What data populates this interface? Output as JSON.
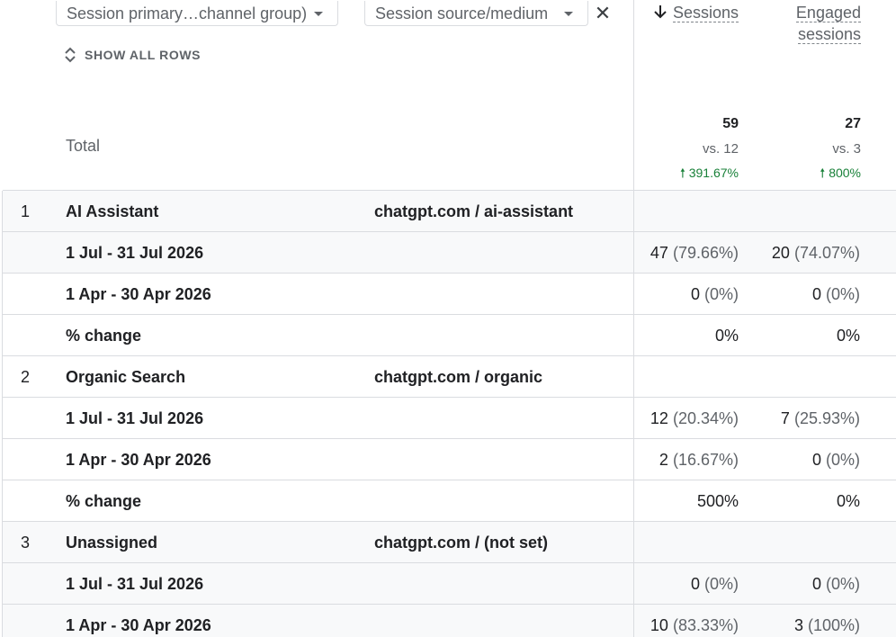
{
  "filters": {
    "primary_dimension": "Session primary…channel group)",
    "secondary_dimension": "Session source/medium"
  },
  "show_all_rows_label": "SHOW ALL ROWS",
  "columns": {
    "sessions": "Sessions",
    "engaged_line1": "Engaged",
    "engaged_line2": "sessions"
  },
  "total": {
    "label": "Total",
    "sessions": "59",
    "sessions_vs": "vs. 12",
    "sessions_change": "391.67%",
    "engaged": "27",
    "engaged_vs": "vs. 3",
    "engaged_change": "800%"
  },
  "rows": [
    {
      "type": "group",
      "num": "1",
      "channel": "AI Assistant",
      "source": "chatgpt.com / ai-assistant"
    },
    {
      "type": "period",
      "label": "1 Jul - 31 Jul 2026",
      "sessions": "47",
      "sessions_pct": "(79.66%)",
      "engaged": "20",
      "engaged_pct": "(74.07%)"
    },
    {
      "type": "period",
      "label": "1 Apr - 30 Apr 2026",
      "sessions": "0",
      "sessions_pct": "(0%)",
      "engaged": "0",
      "engaged_pct": "(0%)"
    },
    {
      "type": "change",
      "label": "% change",
      "sessions": "0%",
      "engaged": "0%"
    },
    {
      "type": "group",
      "num": "2",
      "channel": "Organic Search",
      "source": "chatgpt.com / organic"
    },
    {
      "type": "period",
      "label": "1 Jul - 31 Jul 2026",
      "sessions": "12",
      "sessions_pct": "(20.34%)",
      "engaged": "7",
      "engaged_pct": "(25.93%)"
    },
    {
      "type": "period",
      "label": "1 Apr - 30 Apr 2026",
      "sessions": "2",
      "sessions_pct": "(16.67%)",
      "engaged": "0",
      "engaged_pct": "(0%)"
    },
    {
      "type": "change",
      "label": "% change",
      "sessions": "500%",
      "engaged": "0%"
    },
    {
      "type": "group",
      "num": "3",
      "channel": "Unassigned",
      "source": "chatgpt.com / (not set)"
    },
    {
      "type": "period",
      "label": "1 Jul - 31 Jul 2026",
      "sessions": "0",
      "sessions_pct": "(0%)",
      "engaged": "0",
      "engaged_pct": "(0%)"
    },
    {
      "type": "period",
      "label": "1 Apr - 30 Apr 2026",
      "sessions": "10",
      "sessions_pct": "(83.33%)",
      "engaged": "3",
      "engaged_pct": "(100%)"
    }
  ],
  "colors": {
    "border": "#dadce0",
    "muted_text": "#5f6368",
    "positive_change": "#188038",
    "row_shade": "#f8f9fa"
  }
}
